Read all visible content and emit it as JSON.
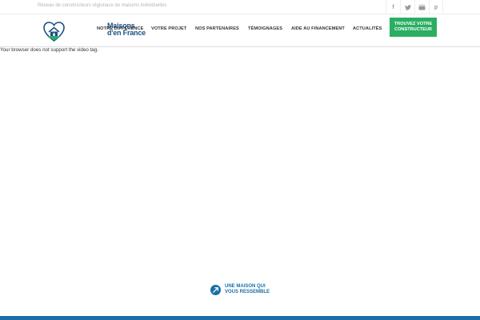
{
  "topbar": {
    "tagline": "Réseau de constructeurs régionaux de maisons individuelles",
    "social_icons": [
      "facebook-icon",
      "twitter-icon",
      "youtube-icon",
      "pinterest-icon"
    ]
  },
  "header": {
    "logo_line1": "Maisons",
    "logo_line2": "d'en France",
    "nav": [
      "NOTRE DIFFÉRENCE",
      "VOTRE PROJET",
      "NOS PARTENAIRES",
      "TÉMOIGNAGES",
      "AIDE AU FINANCEMENT",
      "ACTUALITÉS"
    ],
    "cta_line1": "TROUVEZ VOTRE",
    "cta_line2": "CONSTRUCTEUR"
  },
  "video": {
    "fallback_text": "Your browser does not support the video tag."
  },
  "scroll_cue": {
    "line1": "UNE MAISON QUI",
    "line2": "VOUS RESSEMBLE"
  },
  "colors": {
    "brand_blue": "#1b6ea8",
    "logo_blue": "#1c4f86",
    "cta_green": "#2aae62"
  }
}
